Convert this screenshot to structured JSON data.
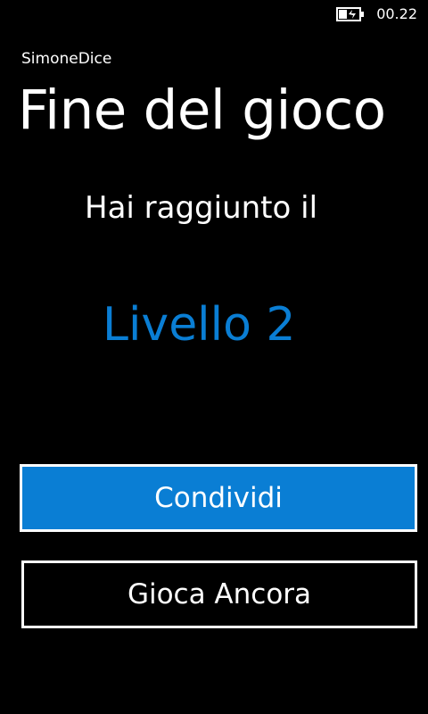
{
  "status_bar": {
    "battery_icon": "battery-charging-icon",
    "time": "00.22"
  },
  "app": {
    "title": "SimoneDice"
  },
  "page": {
    "title": "Fine del gioco",
    "subtitle": "Hai raggiunto il",
    "level": "Livello 2"
  },
  "buttons": {
    "share_label": "Condividi",
    "play_again_label": "Gioca Ancora"
  },
  "colors": {
    "background": "#000000",
    "accent": "#0a7ed4",
    "text": "#ffffff"
  }
}
